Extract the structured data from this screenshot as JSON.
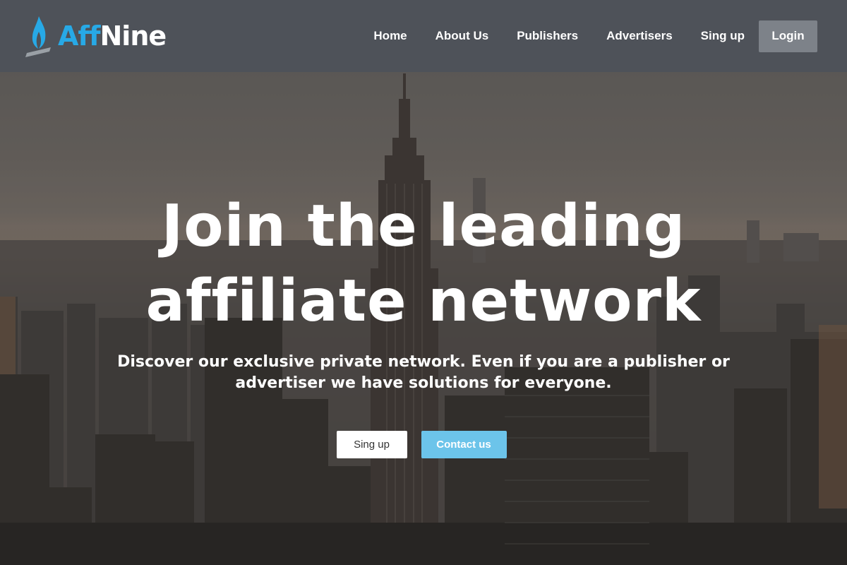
{
  "brand": {
    "name_part1": "Aff",
    "name_part2": "Nine",
    "logo_icon": "flame-logo-icon",
    "color_accent": "#27a9e6"
  },
  "nav": {
    "items": [
      {
        "label": "Home"
      },
      {
        "label": "About Us"
      },
      {
        "label": "Publishers"
      },
      {
        "label": "Advertisers"
      },
      {
        "label": "Sing up"
      }
    ],
    "login_label": "Login"
  },
  "hero": {
    "headline": "Join the leading affiliate network",
    "subtext": "Discover our exclusive private network. Even if you are a publisher or advertiser we have solutions for everyone.",
    "signup_label": "Sing up",
    "contact_label": "Contact us",
    "contact_color": "#6cc4ea"
  }
}
